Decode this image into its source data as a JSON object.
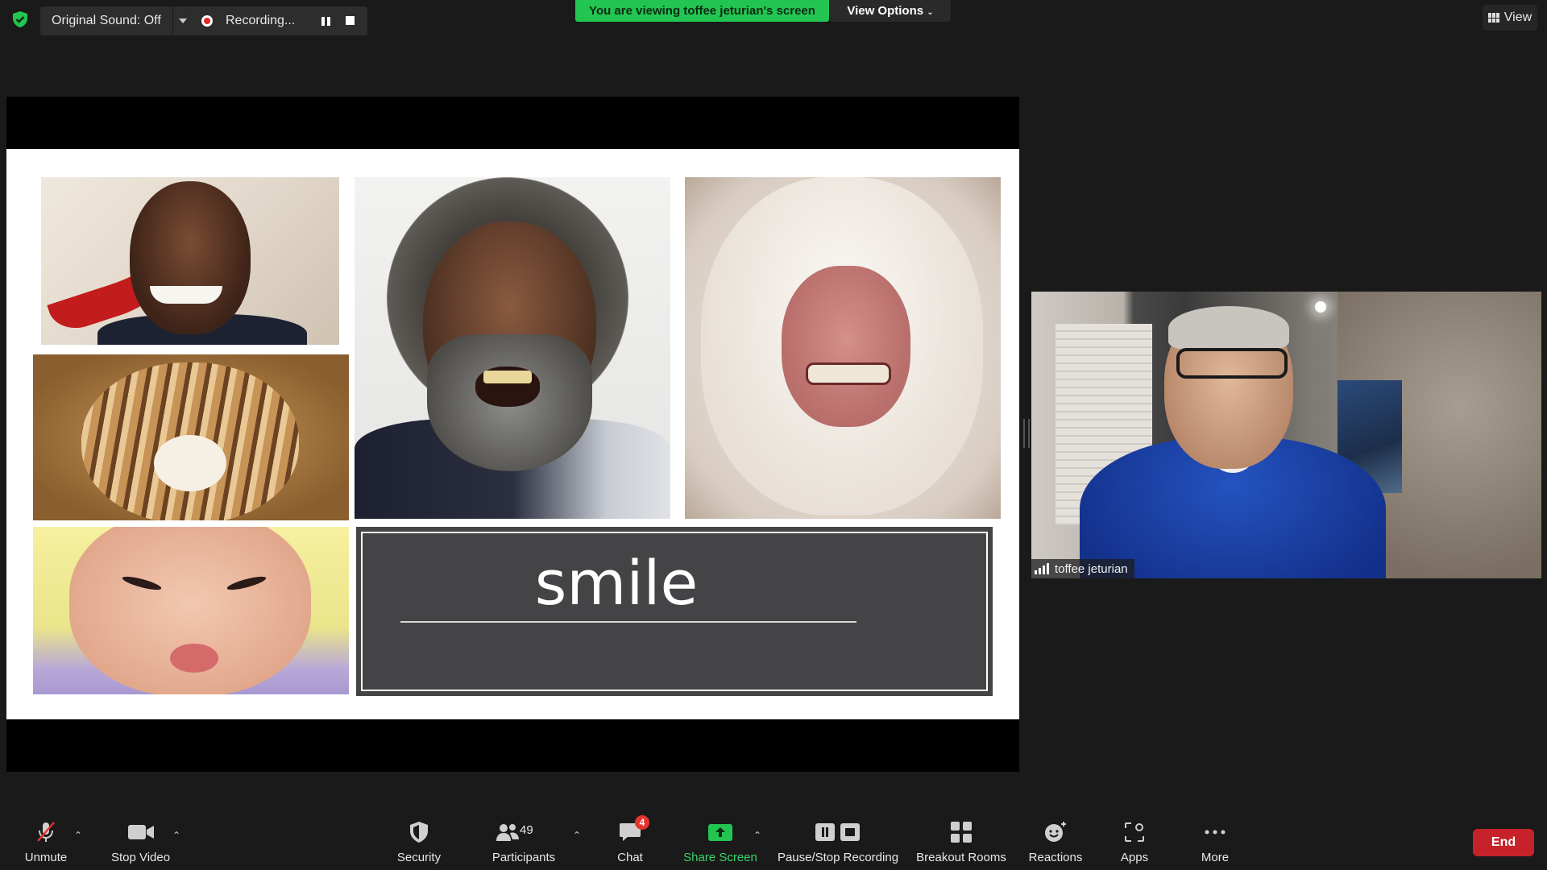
{
  "topbar": {
    "original_sound_label": "Original Sound: Off",
    "recording_label": "Recording...",
    "viewing_banner": "You are viewing toffee jeturian's screen",
    "view_options_label": "View Options",
    "view_button_label": "View"
  },
  "slide": {
    "title_text": "smile"
  },
  "participant": {
    "name": "toffee jeturian"
  },
  "toolbar": {
    "unmute": "Unmute",
    "stop_video": "Stop Video",
    "security": "Security",
    "participants": "Participants",
    "participants_count": "49",
    "chat": "Chat",
    "chat_badge": "4",
    "share_screen": "Share Screen",
    "pause_stop_recording": "Pause/Stop Recording",
    "breakout_rooms": "Breakout Rooms",
    "reactions": "Reactions",
    "apps": "Apps",
    "more": "More",
    "end": "End"
  },
  "colors": {
    "background": "#1a1a1a",
    "share_green": "#23c552",
    "end_red": "#c7222a",
    "badge_red": "#e5332e"
  }
}
